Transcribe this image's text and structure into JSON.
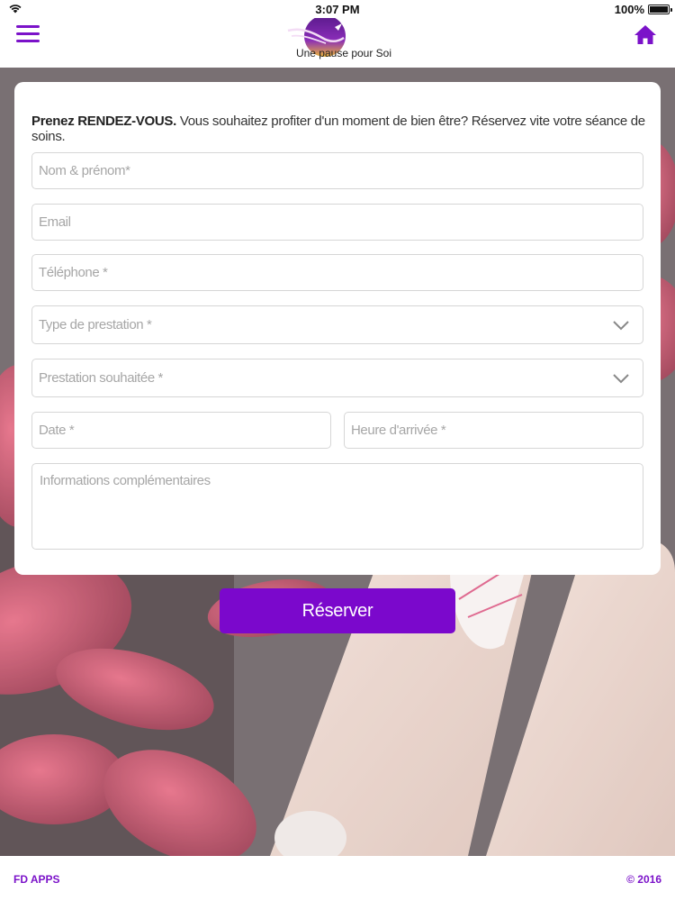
{
  "status_bar": {
    "time": "3:07 PM",
    "battery": "100%",
    "wifi_icon": "wifi-icon",
    "battery_icon": "battery-icon"
  },
  "header": {
    "menu_icon": "hamburger-menu-icon",
    "home_icon": "home-icon",
    "logo_text": "Une pause pour Soi",
    "accent_color": "#7b12c9"
  },
  "form": {
    "intro_bold": "Prenez RENDEZ-VOUS.",
    "intro_text": " Vous souhaitez profiter d'un moment de bien être? Réservez vite votre séance de soins.",
    "fields": {
      "name": {
        "placeholder": "Nom & prénom*",
        "value": ""
      },
      "email": {
        "placeholder": "Email",
        "value": ""
      },
      "phone": {
        "placeholder": "Téléphone *",
        "value": ""
      },
      "service_type": {
        "placeholder": "Type de prestation *",
        "value": ""
      },
      "service": {
        "placeholder": "Prestation souhaitée *",
        "value": ""
      },
      "date": {
        "placeholder": "Date *",
        "value": ""
      },
      "arrival_time": {
        "placeholder": "Heure d'arrivée *",
        "value": ""
      },
      "info": {
        "placeholder": "Informations complémentaires",
        "value": ""
      }
    }
  },
  "reserve_button": {
    "label": "Réserver",
    "color": "#7b08cc"
  },
  "footer": {
    "left": "FD APPS",
    "right": "© 2016"
  }
}
